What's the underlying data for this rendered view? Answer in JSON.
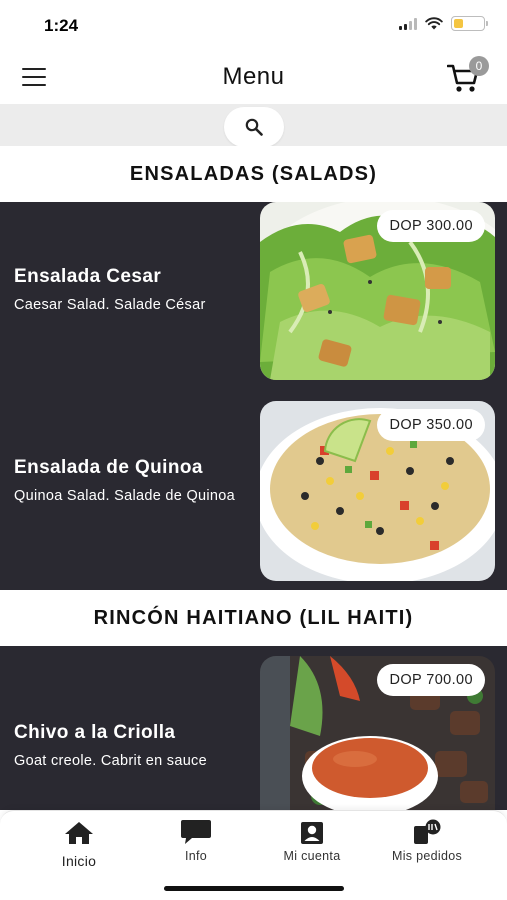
{
  "status_bar": {
    "time": "1:24"
  },
  "header": {
    "title": "Menu",
    "cart_count": "0"
  },
  "sections": [
    {
      "title": "ENSALADAS (SALADS)"
    },
    {
      "title": "RINCÓN HAITIANO (LIL HAITI)"
    }
  ],
  "items": [
    {
      "name": "Ensalada Cesar",
      "description": "Caesar Salad. Salade César",
      "price": "DOP 300.00"
    },
    {
      "name": "Ensalada de Quinoa",
      "description": "Quinoa Salad. Salade de Quinoa",
      "price": "DOP 350.00"
    },
    {
      "name": "Chivo a la Criolla",
      "description": "Goat creole. Cabrit en sauce",
      "price": "DOP 700.00"
    }
  ],
  "tabs": [
    {
      "label": "Inicio",
      "icon": "home-icon"
    },
    {
      "label": "Info",
      "icon": "chat-icon"
    },
    {
      "label": "Mi cuenta",
      "icon": "account-icon"
    },
    {
      "label": "Mis pedidos",
      "icon": "orders-icon"
    }
  ],
  "colors": {
    "item_background": "#2a2931",
    "search_strip": "#ececec",
    "battery_low": "#f4c542",
    "badge": "#9a9a9a"
  }
}
